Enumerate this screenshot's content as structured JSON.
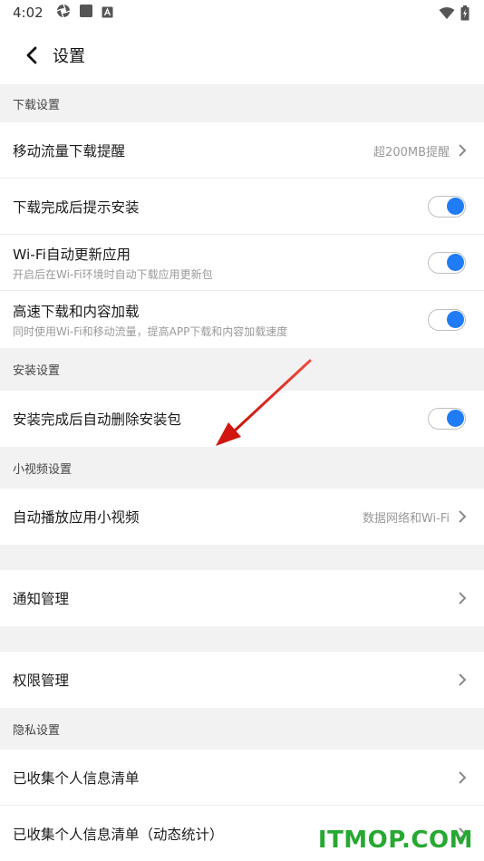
{
  "status_bar": {
    "time": "4:02"
  },
  "header": {
    "title": "设置"
  },
  "sections": {
    "download": {
      "header": "下载设置"
    },
    "install": {
      "header": "安装设置"
    },
    "short_video": {
      "header": "小视频设置"
    },
    "privacy": {
      "header": "隐私设置"
    }
  },
  "rows": {
    "mobile_data_reminder": {
      "title": "移动流量下载提醒",
      "value": "超200MB提醒"
    },
    "prompt_install": {
      "title": "下载完成后提示安装",
      "enabled": true
    },
    "wifi_auto_update": {
      "title": "Wi-Fi自动更新应用",
      "subtitle": "开启后在Wi-Fi环境时自动下载应用更新包",
      "enabled": true
    },
    "high_speed": {
      "title": "高速下载和内容加载",
      "subtitle": "同时使用Wi-Fi和移动流量，提高APP下载和内容加载速度",
      "enabled": true
    },
    "auto_delete_package": {
      "title": "安装完成后自动删除安装包",
      "enabled": true
    },
    "autoplay_video": {
      "title": "自动播放应用小视频",
      "value": "数据网络和Wi-Fi"
    },
    "notification": {
      "title": "通知管理"
    },
    "permissions": {
      "title": "权限管理"
    },
    "personal_info_list": {
      "title": "已收集个人信息清单"
    },
    "personal_info_stats": {
      "title": "已收集个人信息清单（动态统计）"
    }
  },
  "colors": {
    "toggle_on": "#1f7cf5",
    "arrow": "#e0201a",
    "watermark": "#27a832"
  },
  "watermark": "ITMOP.COM"
}
